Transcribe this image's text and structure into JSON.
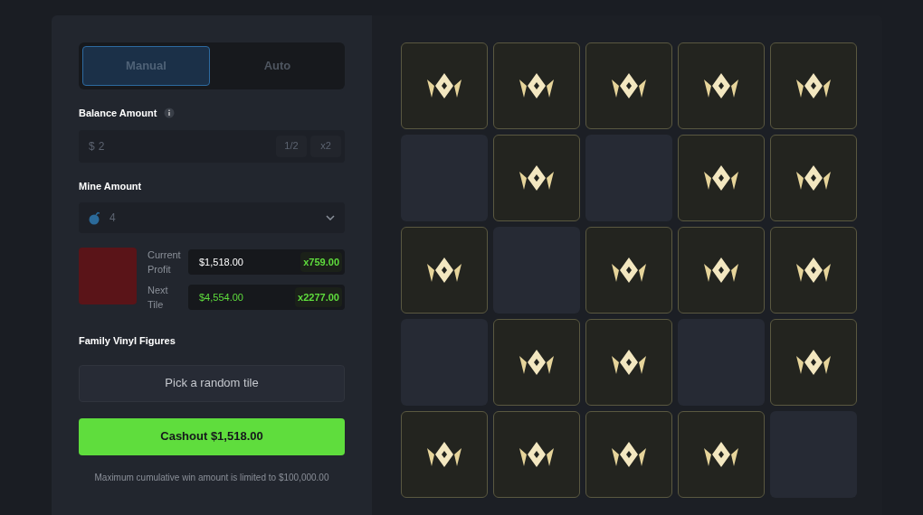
{
  "tabs": [
    {
      "label": "Manual",
      "selected": true
    },
    {
      "label": "Auto",
      "selected": false
    }
  ],
  "balance": {
    "label": "Balance Amount",
    "currency": "$",
    "value": "2",
    "buttons": [
      "1/2",
      "x2"
    ]
  },
  "mines": {
    "label": "Mine Amount",
    "value": "4"
  },
  "prize": {
    "name": "Family Vinyl Figures",
    "rows": [
      {
        "label": "Current Profit",
        "amount": "$1,518.00",
        "multiplier": "x759.00",
        "highlight": false
      },
      {
        "label": "Next Tile",
        "amount": "$4,554.00",
        "multiplier": "x2277.00",
        "highlight": true
      }
    ]
  },
  "random_button": "Pick a random tile",
  "cashout_button": "Cashout $1,518.00",
  "note": "Maximum cumulative win amount is limited to $100,000.00",
  "tiles": [
    {
      "revealed": true
    },
    {
      "revealed": true
    },
    {
      "revealed": true
    },
    {
      "revealed": true
    },
    {
      "revealed": true
    },
    {
      "revealed": false
    },
    {
      "revealed": true
    },
    {
      "revealed": false
    },
    {
      "revealed": true
    },
    {
      "revealed": true
    },
    {
      "revealed": true
    },
    {
      "revealed": false
    },
    {
      "revealed": true
    },
    {
      "revealed": true
    },
    {
      "revealed": true
    },
    {
      "revealed": false
    },
    {
      "revealed": true
    },
    {
      "revealed": true
    },
    {
      "revealed": false
    },
    {
      "revealed": true
    },
    {
      "revealed": true
    },
    {
      "revealed": true
    },
    {
      "revealed": true
    },
    {
      "revealed": true
    },
    {
      "revealed": false
    }
  ]
}
